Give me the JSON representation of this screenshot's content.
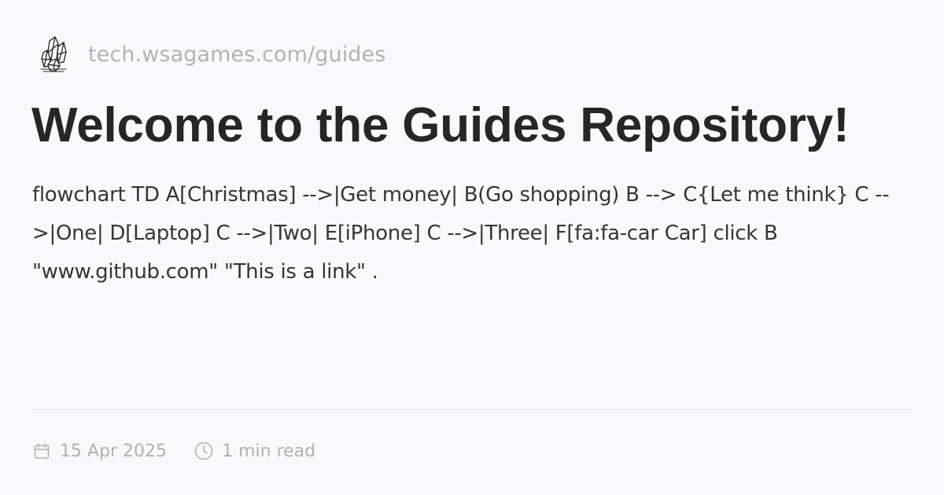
{
  "site": {
    "logo_icon": "crystal-cluster-icon",
    "url": "tech.wsagames.com/guides"
  },
  "article": {
    "title": "Welcome to the Guides Repository!",
    "description": "flowchart TD A[Christmas] -->|Get money| B(Go shopping) B --> C{Let me think} C -->|One| D[Laptop] C -->|Two| E[iPhone] C -->|Three| F[fa:fa-car Car] click B \"www.github.com\" \"This is a link\" ."
  },
  "meta": {
    "date_icon": "calendar-icon",
    "date": "15 Apr 2025",
    "read_time_icon": "clock-icon",
    "read_time": "1 min read"
  },
  "colors": {
    "background": "#f9f8fa",
    "title": "#262627",
    "body_text": "#363636",
    "muted_text": "#b4b2b6",
    "divider": "#e6e4e8"
  }
}
